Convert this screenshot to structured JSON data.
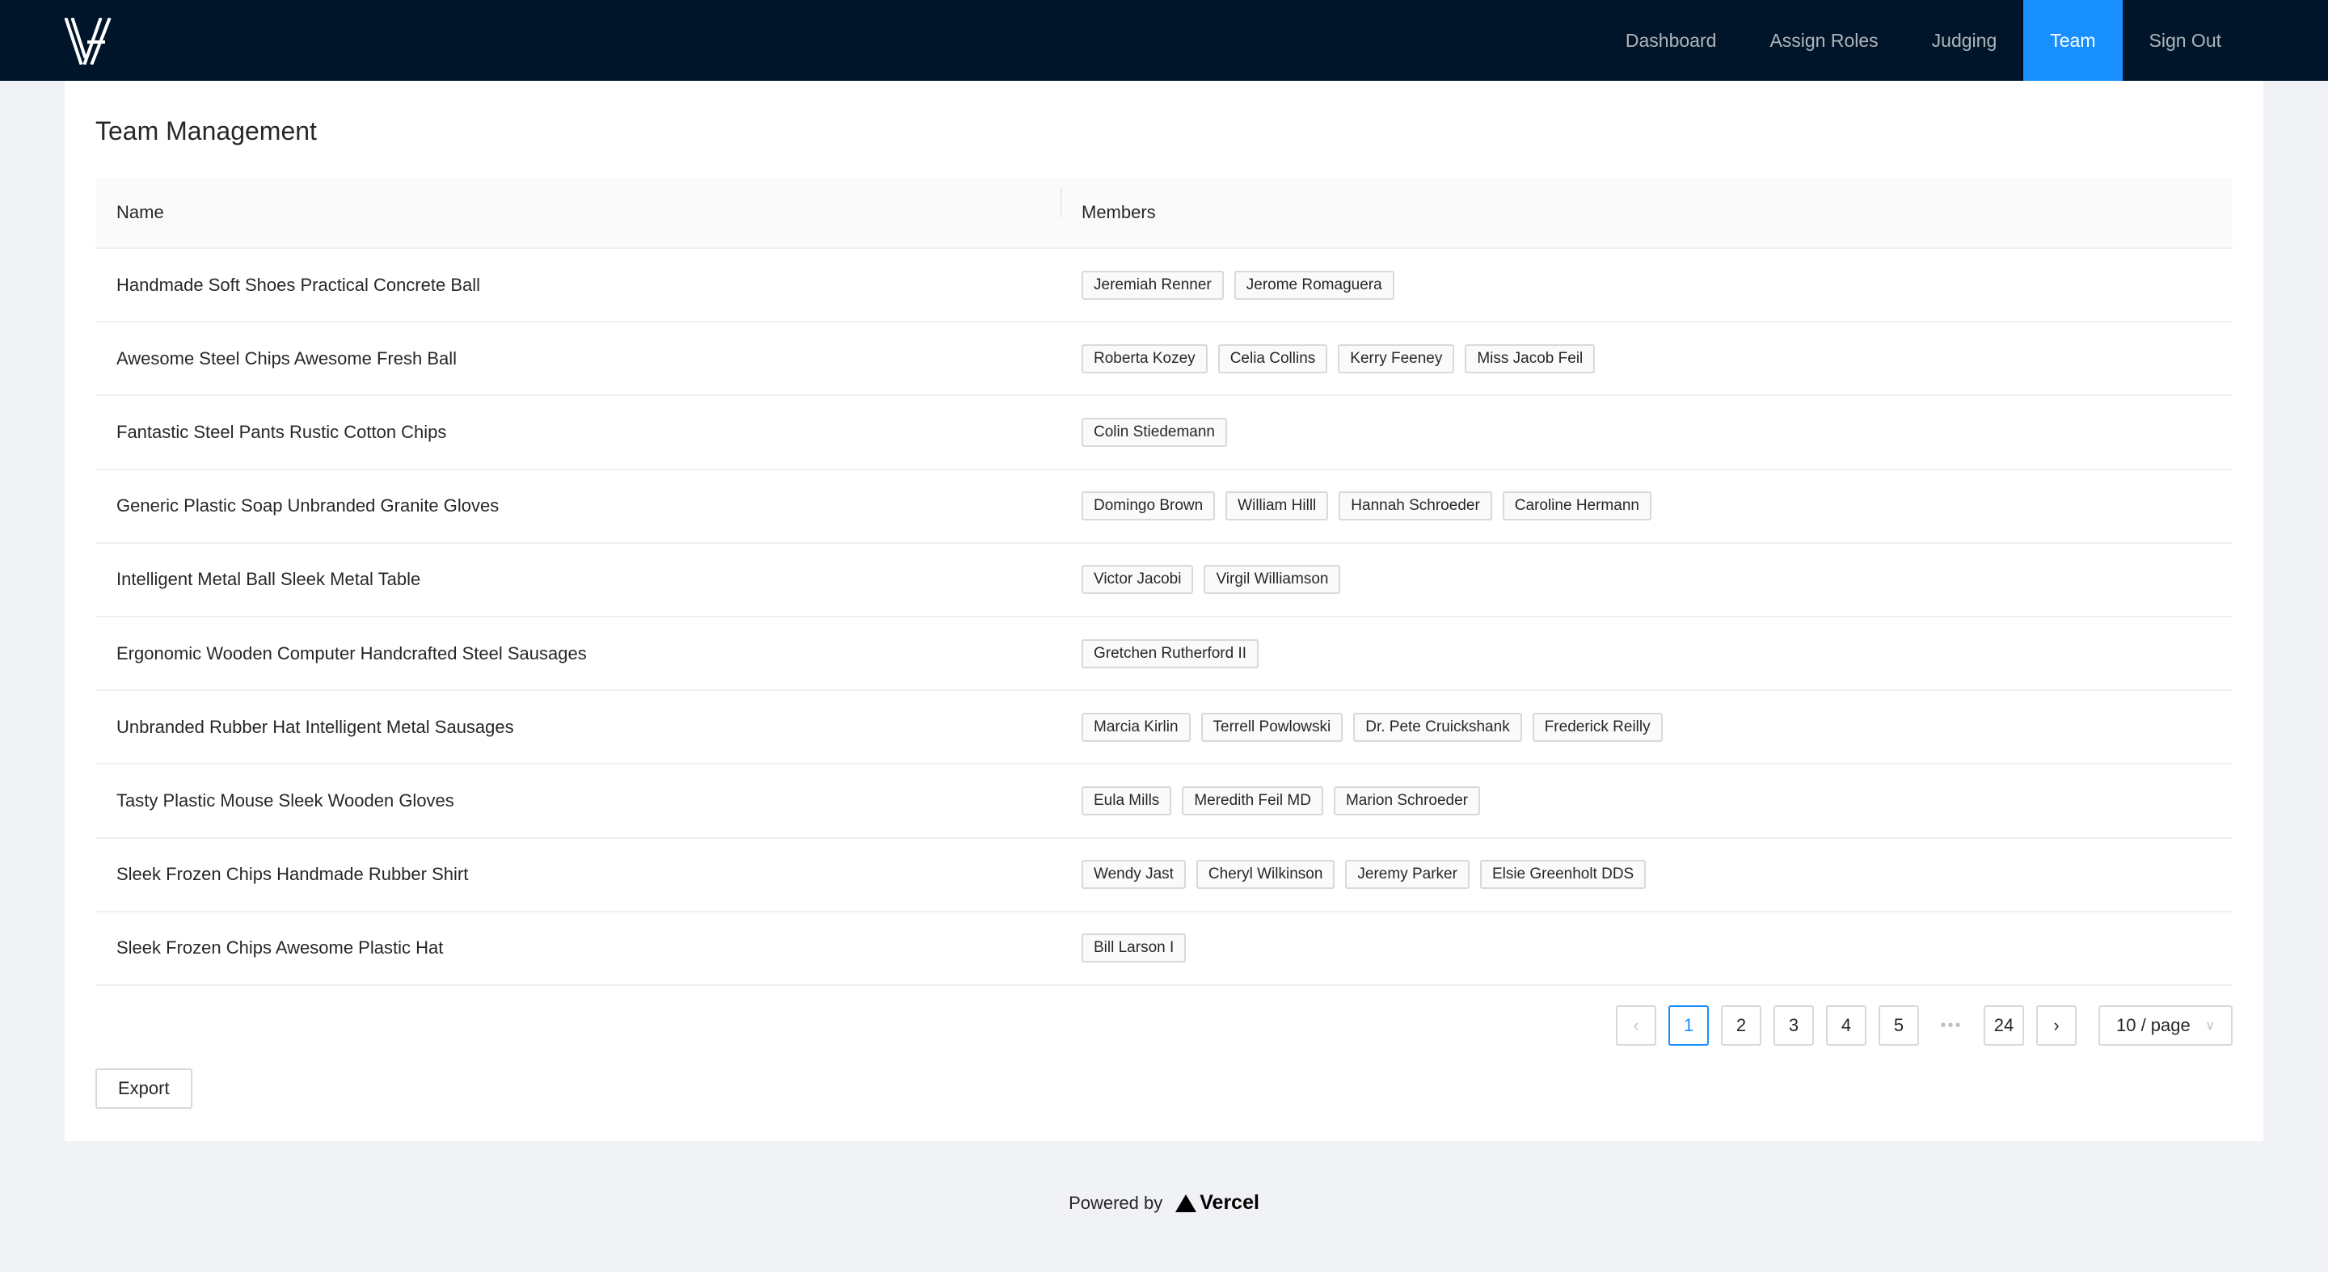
{
  "header": {
    "logo": "V-logo",
    "nav": [
      {
        "label": "Dashboard",
        "active": false
      },
      {
        "label": "Assign Roles",
        "active": false
      },
      {
        "label": "Judging",
        "active": false
      },
      {
        "label": "Team",
        "active": true
      },
      {
        "label": "Sign Out",
        "active": false
      }
    ]
  },
  "page": {
    "title": "Team Management"
  },
  "table": {
    "columns": [
      "Name",
      "Members"
    ],
    "rows": [
      {
        "name": "Handmade Soft Shoes Practical Concrete Ball",
        "members": [
          "Jeremiah Renner",
          "Jerome Romaguera"
        ]
      },
      {
        "name": "Awesome Steel Chips Awesome Fresh Ball",
        "members": [
          "Roberta Kozey",
          "Celia Collins",
          "Kerry Feeney",
          "Miss Jacob Feil"
        ]
      },
      {
        "name": "Fantastic Steel Pants Rustic Cotton Chips",
        "members": [
          "Colin Stiedemann"
        ]
      },
      {
        "name": "Generic Plastic Soap Unbranded Granite Gloves",
        "members": [
          "Domingo Brown",
          "William Hilll",
          "Hannah Schroeder",
          "Caroline Hermann"
        ]
      },
      {
        "name": "Intelligent Metal Ball Sleek Metal Table",
        "members": [
          "Victor Jacobi",
          "Virgil Williamson"
        ]
      },
      {
        "name": "Ergonomic Wooden Computer Handcrafted Steel Sausages",
        "members": [
          "Gretchen Rutherford II"
        ]
      },
      {
        "name": "Unbranded Rubber Hat Intelligent Metal Sausages",
        "members": [
          "Marcia Kirlin",
          "Terrell Powlowski",
          "Dr. Pete Cruickshank",
          "Frederick Reilly"
        ]
      },
      {
        "name": "Tasty Plastic Mouse Sleek Wooden Gloves",
        "members": [
          "Eula Mills",
          "Meredith Feil MD",
          "Marion Schroeder"
        ]
      },
      {
        "name": "Sleek Frozen Chips Handmade Rubber Shirt",
        "members": [
          "Wendy Jast",
          "Cheryl Wilkinson",
          "Jeremy Parker",
          "Elsie Greenholt DDS"
        ]
      },
      {
        "name": "Sleek Frozen Chips Awesome Plastic Hat",
        "members": [
          "Bill Larson I"
        ]
      }
    ]
  },
  "pagination": {
    "prev_icon": "‹",
    "next_icon": "›",
    "pages": [
      "1",
      "2",
      "3",
      "4",
      "5"
    ],
    "current": "1",
    "ellipsis": "•••",
    "last": "24",
    "page_size": "10 / page",
    "page_size_icon": "∨"
  },
  "actions": {
    "export_label": "Export"
  },
  "footer": {
    "powered_by": "Powered by",
    "brand": "Vercel"
  },
  "colors": {
    "header_bg": "#001529",
    "accent": "#1890ff",
    "page_bg": "#f0f2f5"
  }
}
